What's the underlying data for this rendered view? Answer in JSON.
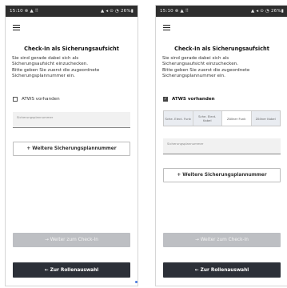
{
  "screens": [
    {
      "status": {
        "time_icons": "15:10 ⊗ ▲ ⠿",
        "right_icons": "▲ ◂ ⊙ ◔ 26%▮"
      },
      "title": "Check-In als Sicherungsaufsicht",
      "intro_lines": [
        "Sie sind gerade dabei sich als",
        "Sicherungsaufsicht einzuchecken.",
        "Bitte geben Sie zuerst die zugeordnete",
        "Sicherungsplannummer ein."
      ],
      "checkbox_label": "ATWS vorhanden",
      "checkbox_checked": false,
      "input_placeholder": "Sicherungsplannummer",
      "add_button": "+ Weitere Sicherungsplannummer",
      "next_button": "→ Weiter zum Check-In",
      "back_button": "← Zur Rollenauswahl"
    },
    {
      "status": {
        "time_icons": "15:10 ⊗ ▲ ⠿",
        "right_icons": "▲ ◂ ⊙ ◔ 26%▮"
      },
      "title": "Check-In als Sicherungsaufsicht",
      "intro_lines": [
        "Sie sind gerade dabei sich als",
        "Sicherungsaufsicht einzuchecken.",
        "Bitte geben Sie zuerst die zugeordnete",
        "Sicherungsplannummer ein."
      ],
      "checkbox_label": "ATWS vorhanden",
      "checkbox_checked": true,
      "segments": [
        "Sche. Elect. Funk",
        "Sche. Elect. Kabel",
        "Zöllner Funk",
        "Zöllner Kabel"
      ],
      "active_segment": "Zöllner Funk",
      "input_placeholder": "Sicherungsplannummer",
      "add_button": "+ Weitere Sicherungsplannummer",
      "next_button": "→ Weiter zum Check-In",
      "back_button": "← Zur Rollenauswahl"
    }
  ]
}
